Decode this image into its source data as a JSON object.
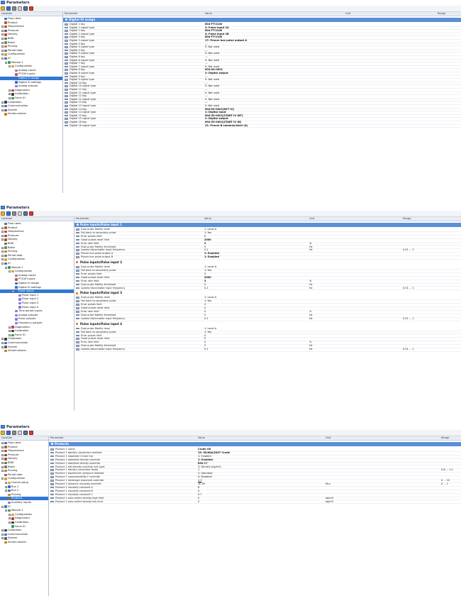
{
  "app": {
    "title": "Parameters"
  },
  "columns": {
    "location": "Location",
    "parameter": "Parameter",
    "value": "Value",
    "unit": "Unit",
    "range": "Range"
  },
  "panel1": {
    "tree": [
      {
        "label": "Flow rates",
        "lvl": 1,
        "exp": "",
        "icon": "#3a6ec8"
      },
      {
        "label": "Product",
        "lvl": 1,
        "exp": "",
        "icon": "#9a6a2a"
      },
      {
        "label": "Temperature",
        "lvl": 1,
        "exp": "+",
        "icon": "#d23b2a"
      },
      {
        "label": "Pressure",
        "lvl": 1,
        "exp": "+",
        "icon": "#5a5a5a"
      },
      {
        "label": "Density",
        "lvl": 1,
        "exp": "+",
        "icon": "#c9402b"
      },
      {
        "label": "BSW",
        "lvl": 1,
        "exp": "+",
        "icon": "#3d8a3d"
      },
      {
        "label": "Batch",
        "lvl": 1,
        "exp": "+",
        "icon": "#7c7c7c"
      },
      {
        "label": "Proving",
        "lvl": 1,
        "exp": "+",
        "icon": "#b08a2a"
      },
      {
        "label": "Period data",
        "lvl": 1,
        "exp": "+",
        "icon": "#6c6c9a"
      },
      {
        "label": "Configuration",
        "lvl": 1,
        "exp": "+",
        "icon": "#e0a020"
      },
      {
        "label": "IO",
        "lvl": 1,
        "exp": "-",
        "icon": "#3a6ec8"
      },
      {
        "label": "Module 1",
        "lvl": 2,
        "exp": "-",
        "icon": "#3a9a5a"
      },
      {
        "label": "Configuration",
        "lvl": 3,
        "exp": "-",
        "icon": "#e0a020"
      },
      {
        "label": "Analog inputs",
        "lvl": 4,
        "exp": "",
        "icon": "#8a7ad8"
      },
      {
        "label": "PT100 inputs",
        "lvl": 4,
        "exp": "",
        "icon": "#d2552a"
      },
      {
        "label": "Digital IO assign",
        "lvl": 4,
        "exp": "",
        "icon": "#3a6ec8",
        "sel": true
      },
      {
        "label": "Digital IO settings",
        "lvl": 4,
        "exp": "",
        "icon": "#3a6ec8"
      },
      {
        "label": "Analog outputs",
        "lvl": 4,
        "exp": "",
        "icon": "#8a7ad8"
      },
      {
        "label": "Diagnostics",
        "lvl": 3,
        "exp": "+",
        "icon": "#c04040"
      },
      {
        "label": "Calibration",
        "lvl": 3,
        "exp": "+",
        "icon": "#3a3a3a"
      },
      {
        "label": "Force IO",
        "lvl": 3,
        "exp": "+",
        "icon": "#3a9a5a"
      },
      {
        "label": "Calibration",
        "lvl": 1,
        "exp": "+",
        "icon": "#3a3a3a"
      },
      {
        "label": "Communication",
        "lvl": 1,
        "exp": "+",
        "icon": "#3a6ec8"
      },
      {
        "label": "System",
        "lvl": 1,
        "exp": "+",
        "icon": "#5a5a5a"
      },
      {
        "label": "Serialnumbers",
        "lvl": 1,
        "exp": "",
        "icon": "#c08020"
      }
    ],
    "band": "Digital IO assign",
    "rows": [
      {
        "p": "Digital 1 tag",
        "v": "604-FT-2100",
        "b": true
      },
      {
        "p": "Digital 1 signal type",
        "v": "3: Pulse input 1A",
        "b": true
      },
      {
        "p": "Digital 2 tag",
        "v": "604-FT-2100",
        "b": true
      },
      {
        "p": "Digital 2 signal type",
        "v": "4: Pulse input 1B",
        "b": true
      },
      {
        "p": "Digital 3 tag",
        "v": "604-FT-2100",
        "b": true
      },
      {
        "p": "Digital 3 signal type",
        "v": "17: Prover bus pulse output A",
        "b": true
      },
      {
        "p": "Digital 4 tag",
        "v": "---"
      },
      {
        "p": "Digital 4 signal type",
        "v": "0: Not used"
      },
      {
        "p": "Digital 5 tag",
        "v": "---"
      },
      {
        "p": "Digital 5 signal type",
        "v": "0: Not used"
      },
      {
        "p": "Digital 6 tag",
        "v": "---"
      },
      {
        "p": "Digital 6 signal type",
        "v": "0: Not used"
      },
      {
        "p": "Digital 7 tag",
        "v": "---"
      },
      {
        "p": "Digital 7 signal type",
        "v": "0: Not used"
      },
      {
        "p": "Digital 8 tag",
        "v": "604-XA-0001",
        "b": true
      },
      {
        "p": "Digital 8 signal type",
        "v": "2: Digital output",
        "b": true
      },
      {
        "p": "Digital 9 tag",
        "v": "---"
      },
      {
        "p": "Digital 9 signal type",
        "v": "0: Not used"
      },
      {
        "p": "Digital 10 tag",
        "v": "---"
      },
      {
        "p": "Digital 10 signal type",
        "v": "0: Not used"
      },
      {
        "p": "Digital 11 tag",
        "v": "---"
      },
      {
        "p": "Digital 11 signal type",
        "v": "0: Not used"
      },
      {
        "p": "Digital 12 tag",
        "v": "---"
      },
      {
        "p": "Digital 12 signal type",
        "v": "0: Not used"
      },
      {
        "p": "Digital 13 tag",
        "v": "---"
      },
      {
        "p": "Digital 13 signal type",
        "v": "0: Not used"
      },
      {
        "p": "Digital 14 tag",
        "v": "604-XS-0001[RST IV]",
        "b": true
      },
      {
        "p": "Digital 14 signal type",
        "v": "1: Digital input",
        "b": true
      },
      {
        "p": "Digital 15 tag",
        "v": "604-ZS-0001[START IV INT]",
        "b": true
      },
      {
        "p": "Digital 15 signal type",
        "v": "2: Digital output",
        "b": true
      },
      {
        "p": "Digital 16 tag",
        "v": "604-ZS-0001[START IV IN]",
        "b": true
      },
      {
        "p": "Digital 16 signal type",
        "v": "21: Prover B common/start (A)",
        "b": true
      }
    ]
  },
  "panel2": {
    "tree": [
      {
        "label": "Flow rates",
        "lvl": 1,
        "exp": "",
        "icon": "#3a6ec8"
      },
      {
        "label": "Product",
        "lvl": 1,
        "exp": "+",
        "icon": "#9a6a2a"
      },
      {
        "label": "Temperature",
        "lvl": 1,
        "exp": "+",
        "icon": "#d23b2a"
      },
      {
        "label": "Pressure",
        "lvl": 1,
        "exp": "+",
        "icon": "#5a5a5a"
      },
      {
        "label": "Density",
        "lvl": 1,
        "exp": "+",
        "icon": "#c9402b"
      },
      {
        "label": "BSW",
        "lvl": 1,
        "exp": "",
        "icon": "#3d8a3d"
      },
      {
        "label": "Batch",
        "lvl": 1,
        "exp": "+",
        "icon": "#7c7c7c"
      },
      {
        "label": "Proving",
        "lvl": 1,
        "exp": "+",
        "icon": "#b08a2a"
      },
      {
        "label": "Period data",
        "lvl": 1,
        "exp": "+",
        "icon": "#6c6c9a"
      },
      {
        "label": "Configuration",
        "lvl": 1,
        "exp": "+",
        "icon": "#e0a020"
      },
      {
        "label": "IO",
        "lvl": 1,
        "exp": "-",
        "icon": "#3a6ec8"
      },
      {
        "label": "Module 1",
        "lvl": 2,
        "exp": "-",
        "icon": "#3a9a5a"
      },
      {
        "label": "Configuration",
        "lvl": 3,
        "exp": "-",
        "icon": "#e0a020"
      },
      {
        "label": "Analog inputs",
        "lvl": 4,
        "exp": "",
        "icon": "#8a7ad8"
      },
      {
        "label": "PT100 inputs",
        "lvl": 4,
        "exp": "",
        "icon": "#d2552a"
      },
      {
        "label": "Digital IO assign",
        "lvl": 4,
        "exp": "",
        "icon": "#3a6ec8"
      },
      {
        "label": "Digital IO settings",
        "lvl": 4,
        "exp": "",
        "icon": "#3a6ec8"
      },
      {
        "label": "Pulse inputs",
        "lvl": 4,
        "exp": "-",
        "icon": "#3a6ec8",
        "sel": true
      },
      {
        "label": "Pulse input 1",
        "lvl": 5,
        "exp": "",
        "icon": "#8a7ad8"
      },
      {
        "label": "Pulse input 2",
        "lvl": 5,
        "exp": "",
        "icon": "#8a7ad8"
      },
      {
        "label": "Pulse input 3",
        "lvl": 5,
        "exp": "",
        "icon": "#8a7ad8"
      },
      {
        "label": "Pulse input 4",
        "lvl": 5,
        "exp": "",
        "icon": "#8a7ad8"
      },
      {
        "label": "Time period inputs",
        "lvl": 4,
        "exp": "",
        "icon": "#8a7ad8"
      },
      {
        "label": "Analog outputs",
        "lvl": 4,
        "exp": "",
        "icon": "#8a7ad8"
      },
      {
        "label": "Pulse outputs",
        "lvl": 4,
        "exp": "",
        "icon": "#8a7ad8"
      },
      {
        "label": "Frequency outputs",
        "lvl": 4,
        "exp": "",
        "icon": "#8a7ad8"
      },
      {
        "label": "Diagnostics",
        "lvl": 3,
        "exp": "+",
        "icon": "#c04040"
      },
      {
        "label": "Calibration",
        "lvl": 3,
        "exp": "+",
        "icon": "#3a3a3a"
      },
      {
        "label": "Force IO",
        "lvl": 3,
        "exp": "+",
        "icon": "#3a9a5a"
      },
      {
        "label": "Calibration",
        "lvl": 1,
        "exp": "+",
        "icon": "#3a3a3a"
      },
      {
        "label": "Communication",
        "lvl": 1,
        "exp": "+",
        "icon": "#3a6ec8"
      },
      {
        "label": "System",
        "lvl": 1,
        "exp": "+",
        "icon": "#5a5a5a"
      },
      {
        "label": "Serialnumbers",
        "lvl": 1,
        "exp": "",
        "icon": "#c08020"
      }
    ],
    "band": "Pulse inputs\\Pulse input 1",
    "sections": [
      {
        "title": "",
        "rows": [
          {
            "p": "Dual pulse fidelity level",
            "v": "1: Level A"
          },
          {
            "p": "Fall back to secondary pulse",
            "v": "1: Yes"
          },
          {
            "p": "Error pulses limit",
            "v": "0"
          },
          {
            "p": "Good pulses reset limit",
            "v": "2000",
            "b": true
          },
          {
            "p": "Error rate limit",
            "v": "3",
            "b": true,
            "u": "%"
          },
          {
            "p": "Dual pulse fidelity threshold",
            "v": "5",
            "u": "Hz"
          },
          {
            "p": "Lowest discernable input frequency",
            "v": "0.1",
            "u": "Hz",
            "r": "0.01 ... 1"
          },
          {
            "p": "Prover bus pulse output A",
            "v": "1: Enabled",
            "b": true
          },
          {
            "p": "Prover bus pulse output B",
            "v": "1: Enabled",
            "b": true
          }
        ]
      },
      {
        "title": "Pulse inputs\\Pulse input 2",
        "rows": [
          {
            "p": "Dual pulse fidelity level",
            "v": "1: Level A"
          },
          {
            "p": "Fall back to secondary pulse",
            "v": "1: Yes"
          },
          {
            "p": "Error pulses limit",
            "v": "0"
          },
          {
            "p": "Good pulses reset limit",
            "v": "2000",
            "b": true
          },
          {
            "p": "Error rate limit",
            "v": "3",
            "b": true,
            "u": "%"
          },
          {
            "p": "Dual pulse fidelity threshold",
            "v": "5",
            "u": "Hz"
          },
          {
            "p": "Lowest discernable input frequency",
            "v": "0.1",
            "u": "Hz",
            "r": "0.01 ... 1"
          }
        ]
      },
      {
        "title": "Pulse inputs\\Pulse input 3",
        "rows": [
          {
            "p": "Dual pulse fidelity level",
            "v": "1: Level A"
          },
          {
            "p": "Fall back to secondary pulse",
            "v": "1: Yes"
          },
          {
            "p": "Error pulses limit",
            "v": "0"
          },
          {
            "p": "Good pulses reset limit",
            "v": "0"
          },
          {
            "p": "Error rate limit",
            "v": "0",
            "u": "%"
          },
          {
            "p": "Dual pulse fidelity threshold",
            "v": "5",
            "u": "Hz"
          },
          {
            "p": "Lowest discernable input frequency",
            "v": "0.1",
            "u": "Hz",
            "r": "0.01 ... 1"
          }
        ]
      },
      {
        "title": "Pulse inputs\\Pulse input 4",
        "rows": [
          {
            "p": "Dual pulse fidelity level",
            "v": "1: Level A"
          },
          {
            "p": "Fall back to secondary pulse",
            "v": "1: Yes"
          },
          {
            "p": "Error pulses limit",
            "v": "0"
          },
          {
            "p": "Good pulses reset limit",
            "v": "0"
          },
          {
            "p": "Error rate limit",
            "v": "0",
            "u": "%"
          },
          {
            "p": "Dual pulse fidelity threshold",
            "v": "5",
            "u": "Hz"
          },
          {
            "p": "Lowest discernable input frequency",
            "v": "0.1",
            "u": "Hz",
            "r": "0.01 ... 1"
          }
        ]
      }
    ]
  },
  "panel3": {
    "tree": [
      {
        "label": "Flow rates",
        "lvl": 1,
        "exp": "+",
        "icon": "#3a6ec8"
      },
      {
        "label": "Product",
        "lvl": 1,
        "exp": "+",
        "icon": "#9a6a2a"
      },
      {
        "label": "Temperature",
        "lvl": 1,
        "exp": "+",
        "icon": "#d23b2a"
      },
      {
        "label": "Pressure",
        "lvl": 1,
        "exp": "+",
        "icon": "#5a5a5a"
      },
      {
        "label": "Density",
        "lvl": 1,
        "exp": "+",
        "icon": "#c9402b"
      },
      {
        "label": "BSW",
        "lvl": 1,
        "exp": "+",
        "icon": "#3d8a3d"
      },
      {
        "label": "Batch",
        "lvl": 1,
        "exp": "+",
        "icon": "#7c7c7c"
      },
      {
        "label": "Proving",
        "lvl": 1,
        "exp": "+",
        "icon": "#b08a2a"
      },
      {
        "label": "Period data",
        "lvl": 1,
        "exp": "",
        "icon": "#6c6c9a"
      },
      {
        "label": "Configuration",
        "lvl": 1,
        "exp": "-",
        "icon": "#e0a020"
      },
      {
        "label": "Overall setup",
        "lvl": 2,
        "exp": "+",
        "icon": "#e0a020"
      },
      {
        "label": "Run 1",
        "lvl": 2,
        "exp": "+",
        "icon": "#3a6ec8"
      },
      {
        "label": "Run 2",
        "lvl": 2,
        "exp": "+",
        "icon": "#3a6ec8"
      },
      {
        "label": "Proving",
        "lvl": 2,
        "exp": "",
        "icon": "#b08a2a"
      },
      {
        "label": "Products",
        "lvl": 2,
        "exp": "",
        "icon": "#9a6a2a",
        "sel": true
      },
      {
        "label": "Auxiliary inputs",
        "lvl": 2,
        "exp": "",
        "icon": "#8a7ad8"
      },
      {
        "label": "IO",
        "lvl": 1,
        "exp": "-",
        "icon": "#3a6ec8"
      },
      {
        "label": "Module 1",
        "lvl": 2,
        "exp": "-",
        "icon": "#3a9a5a"
      },
      {
        "label": "Configuration",
        "lvl": 3,
        "exp": "+",
        "icon": "#e0a020"
      },
      {
        "label": "Diagnostics",
        "lvl": 3,
        "exp": "+",
        "icon": "#c04040"
      },
      {
        "label": "Calibration",
        "lvl": 3,
        "exp": "+",
        "icon": "#3a3a3a"
      },
      {
        "label": "Force IO",
        "lvl": 3,
        "exp": "",
        "icon": "#3a9a5a"
      },
      {
        "label": "Calibration",
        "lvl": 1,
        "exp": "+",
        "icon": "#3a3a3a"
      },
      {
        "label": "Communication",
        "lvl": 1,
        "exp": "+",
        "icon": "#3a6ec8"
      },
      {
        "label": "System",
        "lvl": 1,
        "exp": "+",
        "icon": "#5a5a5a"
      },
      {
        "label": "Serialnumbers",
        "lvl": 1,
        "exp": "",
        "icon": "#c08020"
      }
    ],
    "band": "Products",
    "rows": [
      {
        "p": "Product 1 name",
        "v": "Crude Oil",
        "b": true
      },
      {
        "p": "Product 1 density conversion method",
        "v": "15: 50/60A/2007 Crude",
        "b": true
      },
      {
        "p": "Product 1 separate CII and Cpl",
        "v": "1: Enabled"
      },
      {
        "p": "Product 1 standard density override",
        "v": "1: Enabled",
        "b": true
      },
      {
        "p": "Product 1 standard density override",
        "v": "850.17",
        "b": true
      },
      {
        "p": "Product 1 std density override unit type",
        "v": "3: Density (kg/m3)"
      },
      {
        "p": "Product 1 density correction factor",
        "v": "1",
        "r": "0.8 ... 1.2"
      },
      {
        "p": "Product 1 equilibrium pressure method",
        "v": "2: Standard"
      },
      {
        "p": "Product 1 compressibility F override",
        "v": "0: Disabled"
      },
      {
        "p": "Product 1 isentropic exponent override",
        "v": "1.3",
        "ul": true,
        "r": "0 ... 10"
      },
      {
        "p": "Product 1 dynamic viscosity override",
        "v": "1E-05",
        "u": "Pa.s",
        "r": "0 ... 1"
      },
      {
        "p": "Product 1 viscosity constant A",
        "v": "6"
      },
      {
        "p": "Product 1 viscosity constant B",
        "v": "0"
      },
      {
        "p": "Product 1 viscosity constant C",
        "v": "0.7"
      },
      {
        "p": "Product 1 auto select density high limit",
        "v": "0",
        "u": "kg/m3"
      },
      {
        "p": "Product 1 auto select density low limit",
        "v": "0",
        "u": "kg/m3"
      }
    ]
  }
}
